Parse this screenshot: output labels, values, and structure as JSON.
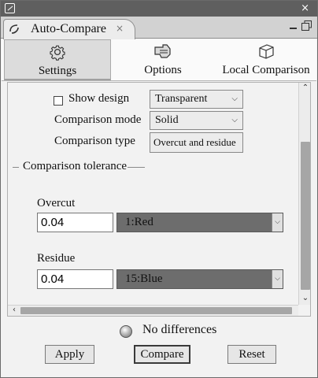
{
  "window": {
    "tab_title": "Auto-Compare",
    "tab_close": "×",
    "title_close": "×"
  },
  "categories": [
    {
      "label": "Settings",
      "icon": "gear-icon",
      "selected": true
    },
    {
      "label": "Options",
      "icon": "hand-pointer-icon",
      "selected": false
    },
    {
      "label": "Local Comparison",
      "icon": "cube-icon",
      "selected": false
    }
  ],
  "settings": {
    "show_design_label": "Show design",
    "show_design_checked": false,
    "show_design_value": "Transparent",
    "comparison_mode_label": "Comparison mode",
    "comparison_mode_value": "Solid",
    "comparison_type_label": "Comparison type",
    "comparison_type_value": "Overcut and residue"
  },
  "tolerance": {
    "group_title": "Comparison tolerance",
    "overcut_label": "Overcut",
    "overcut_value": "0.04",
    "overcut_color": "1:Red",
    "residue_label": "Residue",
    "residue_value": "0.04",
    "residue_color": "15:Blue"
  },
  "status": {
    "text": "No differences"
  },
  "buttons": {
    "apply": "Apply",
    "compare": "Compare",
    "reset": "Reset"
  },
  "colors": {
    "color_select_bg": "#6d6d6d",
    "selected_tab_bg": "#dcdcdc"
  }
}
